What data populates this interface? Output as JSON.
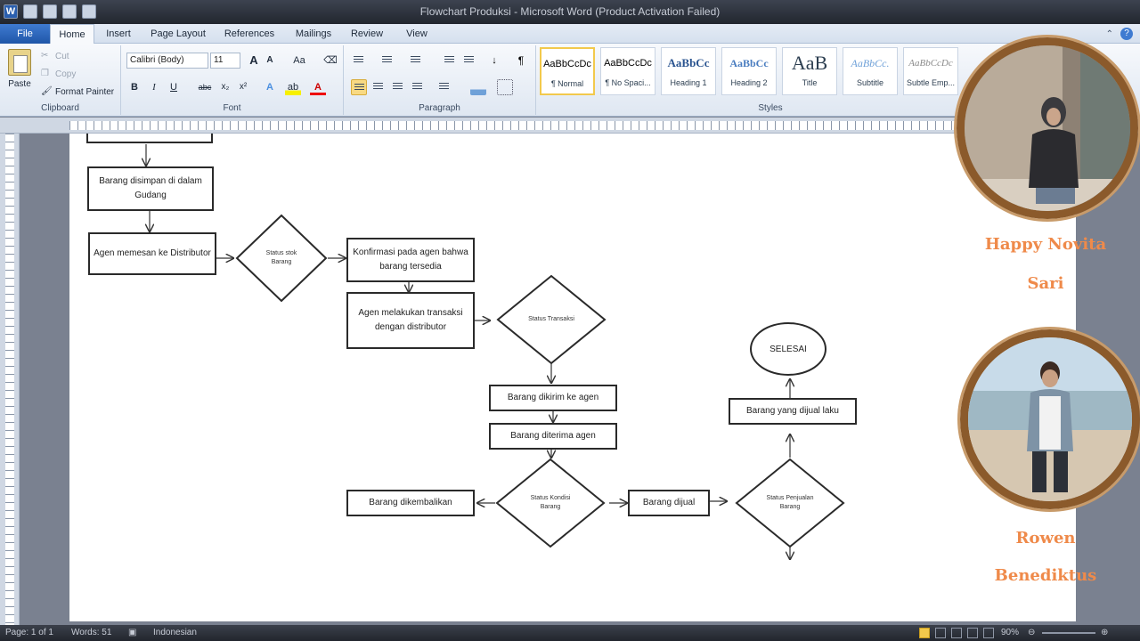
{
  "window": {
    "title": "Flowchart Produksi - Microsoft Word (Product Activation Failed)"
  },
  "tabs": {
    "file": "File",
    "items": [
      "Home",
      "Insert",
      "Page Layout",
      "References",
      "Mailings",
      "Review",
      "View"
    ],
    "active": "Home"
  },
  "ribbon": {
    "clipboard": {
      "paste": "Paste",
      "cut": "Cut",
      "copy": "Copy",
      "format_painter": "Format Painter",
      "label": "Clipboard"
    },
    "font": {
      "family": "Calibri (Body)",
      "size": "11",
      "label": "Font",
      "bold": "B",
      "italic": "I",
      "underline": "U",
      "strike": "abc",
      "subscript": "x₂",
      "superscript": "x²",
      "grow": "A",
      "shrink": "A",
      "case": "Aa"
    },
    "paragraph": {
      "label": "Paragraph"
    },
    "styles": {
      "label": "Styles",
      "items": [
        {
          "sample": "AaBbCcDc",
          "name": "¶ Normal"
        },
        {
          "sample": "AaBbCcDc",
          "name": "¶ No Spaci..."
        },
        {
          "sample": "AaBbCc",
          "name": "Heading 1"
        },
        {
          "sample": "AaBbCc",
          "name": "Heading 2"
        },
        {
          "sample": "AaB",
          "name": "Title"
        },
        {
          "sample": "AaBbCc.",
          "name": "Subtitle"
        },
        {
          "sample": "AaBbCcDc",
          "name": "Subtle Emp..."
        }
      ]
    }
  },
  "flowchart": {
    "box_simpan": "Barang disimpan di dalam Gudang",
    "box_pesan": "Agen memesan ke Distributor",
    "dia_stok": "Status stok Barang",
    "box_konfirmasi": "Konfirmasi pada agen bahwa barang tersedia",
    "box_transaksi": "Agen melakukan transaksi dengan distributor",
    "dia_transaksi": "Status Transaksi",
    "box_kirim": "Barang dikirim ke agen",
    "box_diterima": "Barang diterima agen",
    "dia_kondisi": "Status Kondisi Barang",
    "box_kembali": "Barang dikembalikan",
    "box_dijual": "Barang dijual",
    "dia_penjualan": "Status Penjualan Barang",
    "box_laku": "Barang yang dijual laku",
    "end": "SELESAI"
  },
  "presenters": [
    {
      "name_line1": "Happy Novita",
      "name_line2": "Sari"
    },
    {
      "name_line1": "Rowen",
      "name_line2": "Benediktus"
    }
  ],
  "statusbar": {
    "page": "Page: 1 of 1",
    "words": "Words: 51",
    "language": "Indonesian",
    "zoom": "90%"
  }
}
